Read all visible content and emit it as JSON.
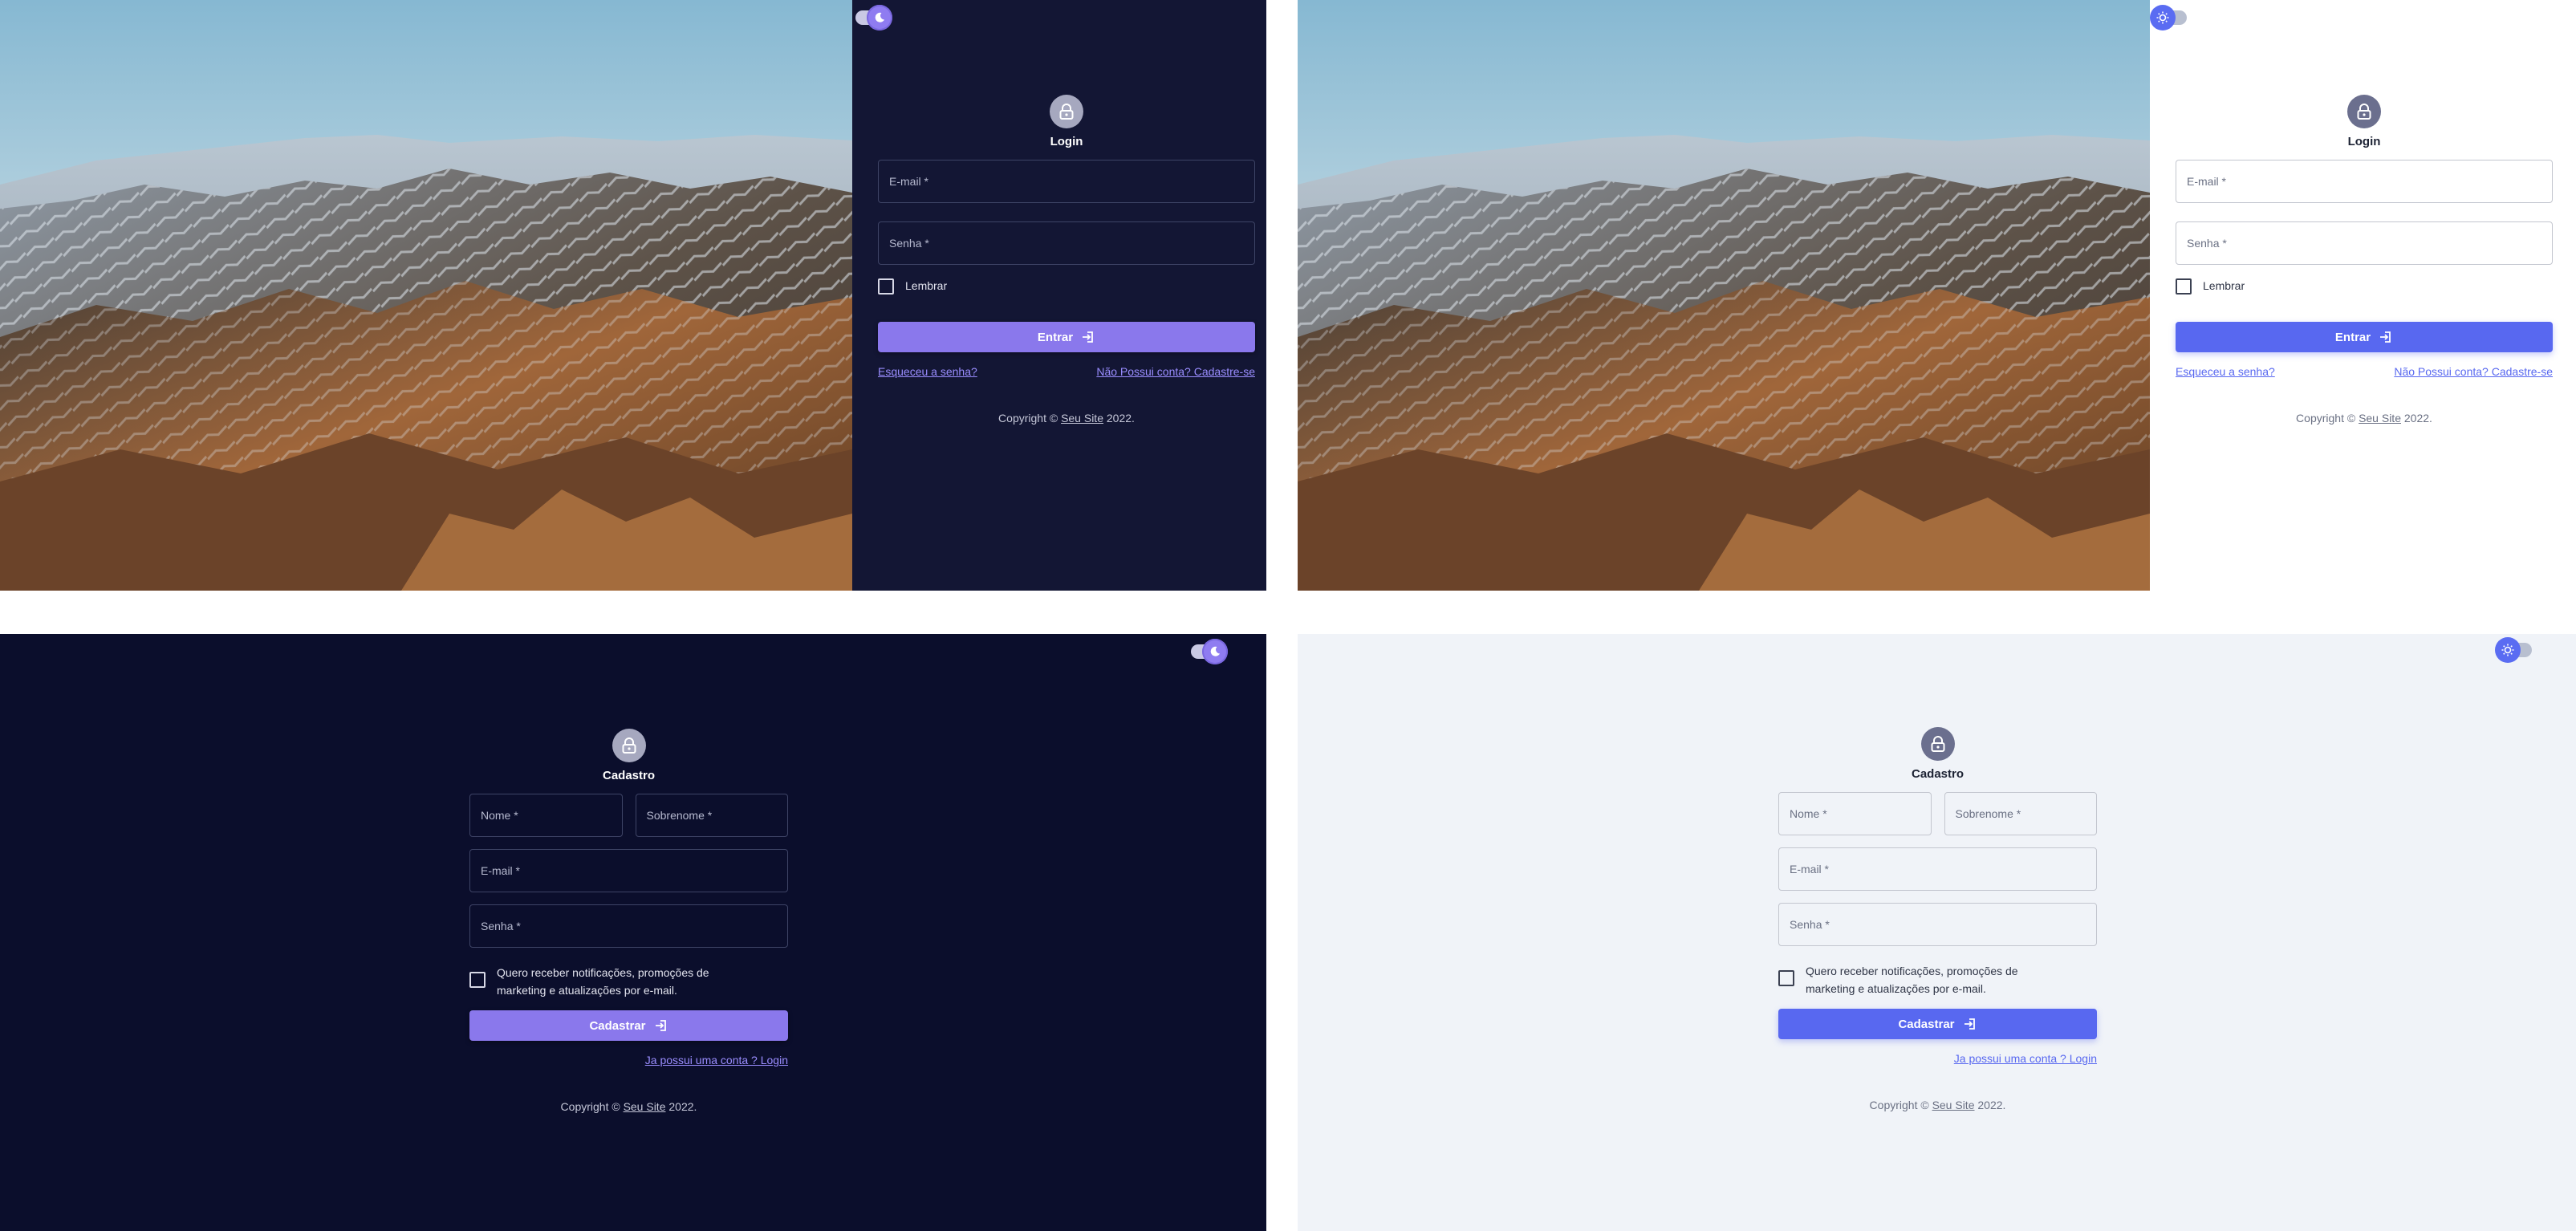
{
  "login": {
    "title": "Login",
    "email_label": "E-mail *",
    "password_label": "Senha *",
    "remember_label": "Lembrar",
    "submit_label": "Entrar",
    "forgot_link": "Esqueceu a senha?",
    "signup_link": "Não Possui conta? Cadastre-se"
  },
  "register": {
    "title": "Cadastro",
    "first_name_label": "Nome *",
    "last_name_label": "Sobrenome *",
    "email_label": "E-mail *",
    "password_label": "Senha *",
    "marketing_label": "Quero receber notificações, promoções de marketing e atualizações por e-mail.",
    "submit_label": "Cadastrar",
    "login_link": "Ja possui uma conta ? Login"
  },
  "footer": {
    "prefix": "Copyright © ",
    "site": "Seu Site",
    "suffix": " 2022."
  },
  "icons": {
    "avatar": "lock-icon",
    "submit": "login-arrow-icon",
    "toggle_dark": "moon-icon",
    "toggle_light": "sun-icon"
  },
  "colors": {
    "dark_panel": "#131634",
    "dark_bg": "#0b0e2c",
    "dark_accent": "#8a78ec",
    "light_accent": "#5868f0",
    "light_bg": "#f0f3f8"
  }
}
